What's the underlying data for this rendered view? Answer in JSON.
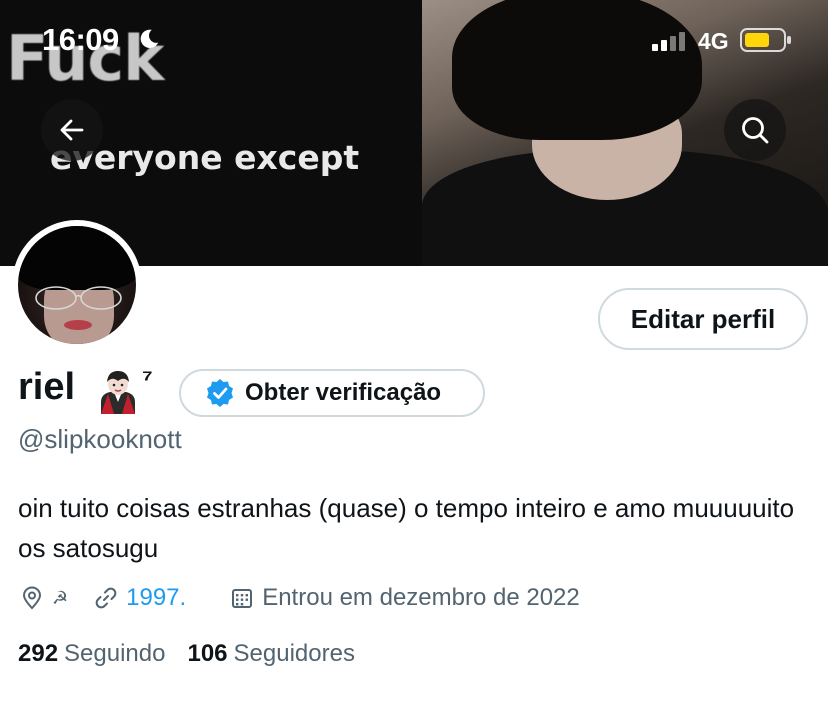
{
  "status_bar": {
    "time": "16:09",
    "network": "4G"
  },
  "banner": {
    "text_big": "Fuck",
    "text_small": "everyone except"
  },
  "header_buttons": {
    "back_icon": "arrow-left-icon",
    "search_icon": "search-icon"
  },
  "profile": {
    "display_name": "riel",
    "name_emoji": "vampire-emoji",
    "name_superscript": "⁷",
    "handle": "@slipkooknott",
    "bio": "oin tuito coisas estranhas (quase) o tempo inteiro e amo muuuuuito os satosugu",
    "location": "☭",
    "link": "1997.",
    "joined": "Entrou em dezembro de 2022",
    "following_count": "292",
    "following_label": "Seguindo",
    "followers_count": "106",
    "followers_label": "Seguidores"
  },
  "buttons": {
    "edit_profile": "Editar perfil",
    "get_verified": "Obter verificação"
  },
  "colors": {
    "accent_blue": "#1d9bf0",
    "text_primary": "#0f1419",
    "text_secondary": "#536471",
    "border": "#cfd9de",
    "battery": "#ffd60a"
  }
}
